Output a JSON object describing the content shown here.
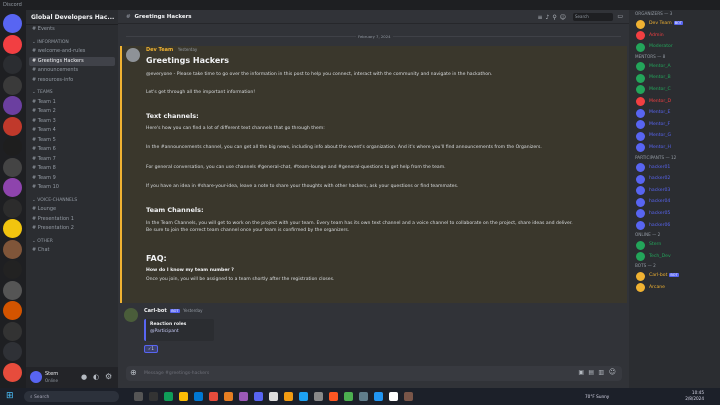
{
  "titlebar": {
    "title": "Discord"
  },
  "guild": {
    "name": "Global Developers Hac..."
  },
  "sidebar": {
    "items": [
      {
        "label": "Events",
        "type": "channel",
        "active": false
      },
      {
        "label": "information",
        "type": "category",
        "active": false
      },
      {
        "label": "welcome-and-rules",
        "type": "channel",
        "active": false
      },
      {
        "label": "Greetings Hackers",
        "type": "channel",
        "active": true
      },
      {
        "label": "announcements",
        "type": "channel",
        "active": false
      },
      {
        "label": "resources-info",
        "type": "channel",
        "active": false
      },
      {
        "label": "teams",
        "type": "category",
        "active": false
      },
      {
        "label": "Team 1",
        "type": "channel",
        "active": false
      },
      {
        "label": "Team 2",
        "type": "channel",
        "active": false
      },
      {
        "label": "Team 3",
        "type": "channel",
        "active": false
      },
      {
        "label": "Team 4",
        "type": "channel",
        "active": false
      },
      {
        "label": "Team 5",
        "type": "channel",
        "active": false
      },
      {
        "label": "Team 6",
        "type": "channel",
        "active": false
      },
      {
        "label": "Team 7",
        "type": "channel",
        "active": false
      },
      {
        "label": "Team 8",
        "type": "channel",
        "active": false
      },
      {
        "label": "Team 9",
        "type": "channel",
        "active": false
      },
      {
        "label": "Team 10",
        "type": "channel",
        "active": false
      },
      {
        "label": "voice-channels",
        "type": "category",
        "active": false
      },
      {
        "label": "Lounge",
        "type": "channel",
        "active": false
      },
      {
        "label": "Presentation 1",
        "type": "channel",
        "active": false
      },
      {
        "label": "Presentation 2",
        "type": "channel",
        "active": false
      },
      {
        "label": "other",
        "type": "category",
        "active": false
      },
      {
        "label": "Chat",
        "type": "channel",
        "active": false
      }
    ]
  },
  "user": {
    "name": "Stern",
    "status": "Online"
  },
  "channel": {
    "name": "Greetings Hackers",
    "search_placeholder": "Search"
  },
  "header_icons": [
    "threads-icon",
    "bell-icon",
    "pin-icon",
    "members-icon"
  ],
  "divider": {
    "date": "February 7, 2024"
  },
  "post": {
    "author": "Dev Team",
    "timestamp": "Yesterday",
    "title": "Greetings Hackers",
    "intro": "@everyone - Please take time to go over the information in this post to help you connect, interact with the community and navigate in the hackathon.",
    "intro2": "Let's get through all the important information!",
    "text_heading": "Text channels:",
    "text_1": "Here's how you can find a lot of different text channels that go through them:",
    "text_2": "In the #announcements channel, you can get all the big news, including info about the event's organization. And it's where you'll find announcements from the Organizers.",
    "text_3": "For general conversation, you can use channels #general-chat, #team-lounge and #general-questions to get help from the team.",
    "text_4": "If you have an idea in #share-your-idea, leave a note to share your thoughts with other hackers, ask your questions or find teammates.",
    "team_heading": "Team Channels:",
    "team_1": "In the Team Channels, you will get to work on the project with your team. Every team has its own text channel and a voice channel to collaborate on the project, share ideas and deliver.",
    "team_2": "Be sure to join the correct team channel once your team is confirmed by the organizers.",
    "faq_heading": "FAQ:",
    "faq_q": "How do I know my team number ?",
    "faq_a": "Once you join, you will be assigned to a team shortly after the registration closes."
  },
  "reply": {
    "author": "Carl-bot",
    "badge": "BOT",
    "timestamp": "Yesterday",
    "embed_title": "Reaction roles",
    "embed_value": "@Participant"
  },
  "composer": {
    "placeholder": "Message #greetings-hackers"
  },
  "members": {
    "groups": [
      {
        "label": "Organizers — 3",
        "members": [
          {
            "name": "Dev Team",
            "badge": "BOT",
            "color": "#f0b232"
          },
          {
            "name": "Admin",
            "color": "#f23f42"
          },
          {
            "name": "Moderator",
            "color": "#23a55a"
          }
        ]
      },
      {
        "label": "Mentors — 8",
        "members": [
          {
            "name": "Mentor_A",
            "color": "#23a55a"
          },
          {
            "name": "Mentor_B",
            "color": "#23a55a"
          },
          {
            "name": "Mentor_C",
            "color": "#23a55a"
          },
          {
            "name": "Mentor_D",
            "color": "#f23f42"
          },
          {
            "name": "Mentor_E",
            "color": "#5865f2"
          },
          {
            "name": "Mentor_F",
            "color": "#5865f2"
          },
          {
            "name": "Mentor_G",
            "color": "#5865f2"
          },
          {
            "name": "Mentor_H",
            "color": "#5865f2"
          }
        ]
      },
      {
        "label": "Participants — 12",
        "members": [
          {
            "name": "hacker01",
            "color": "#5865f2"
          },
          {
            "name": "hacker02",
            "color": "#5865f2"
          },
          {
            "name": "hacker03",
            "color": "#5865f2"
          },
          {
            "name": "hacker04",
            "color": "#5865f2"
          },
          {
            "name": "hacker05",
            "color": "#5865f2"
          },
          {
            "name": "hacker06",
            "color": "#5865f2"
          }
        ]
      },
      {
        "label": "Online — 2",
        "members": [
          {
            "name": "Stern",
            "color": "#23a55a"
          },
          {
            "name": "Tech_Dev",
            "color": "#23a55a"
          }
        ]
      },
      {
        "label": "Bots — 2",
        "members": [
          {
            "name": "Carl-bot",
            "badge": "BOT",
            "color": "#f0b232"
          },
          {
            "name": "Arcane",
            "color": "#f0b232"
          }
        ]
      }
    ]
  },
  "taskbar": {
    "search_placeholder": "Search",
    "time": "10:45",
    "date": "2/8/2024",
    "weather": "70°F Sunny"
  },
  "colors": {
    "accent": "#5865f2",
    "highlight": "#f0b232",
    "online": "#23a55a",
    "danger": "#f23f42"
  }
}
